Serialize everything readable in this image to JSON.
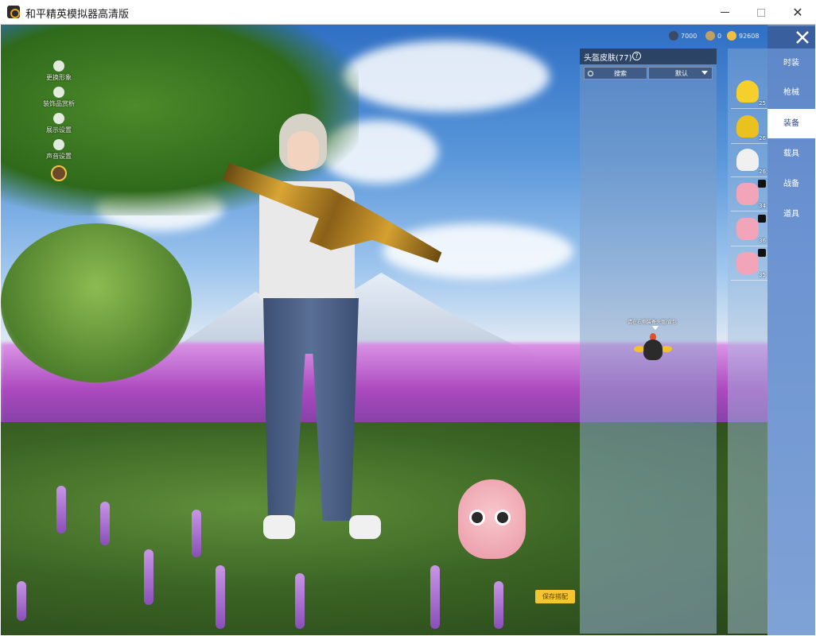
{
  "window": {
    "title": "和平精英模拟器高清版",
    "minimize_icon": "minimize-icon",
    "maximize_icon": "maximize-icon",
    "close_icon": "close-icon"
  },
  "side_menu": {
    "items": [
      {
        "label": "更换形象",
        "icon": "person-icon"
      },
      {
        "label": "装饰品赏析",
        "icon": "puzzle-icon"
      },
      {
        "label": "展示设置",
        "icon": "eye-icon"
      },
      {
        "label": "声音设置",
        "icon": "speaker-icon"
      }
    ],
    "avatar": {
      "icon": "avatar-ring-icon",
      "arrow": "↑"
    }
  },
  "currency": [
    {
      "icon": "coin-dark-icon",
      "value": "7000",
      "color": "#3a4a6a"
    },
    {
      "icon": "coin-silver-icon",
      "value": "0",
      "color": "#c0a060"
    },
    {
      "icon": "coin-gold-icon",
      "value": "92608",
      "color": "#f0c040"
    }
  ],
  "panel": {
    "title": "头盔皮肤(77)",
    "help": "?",
    "search_placeholder": "搜索",
    "sort_label": "默认",
    "preview_hint": "请在右侧装备头盔/背包"
  },
  "items": [
    {
      "name": "pineapple-helmet",
      "level": "25",
      "color": "#f5cf2b",
      "locked": false
    },
    {
      "name": "yellow-helmet",
      "level": "26",
      "color": "#e9c21f",
      "locked": false
    },
    {
      "name": "white-helmet",
      "level": "26",
      "color": "#f0f0f0",
      "locked": false
    },
    {
      "name": "pink-bear-helmet-1",
      "level": "34",
      "color": "#f2a4b8",
      "locked": true
    },
    {
      "name": "pink-bear-helmet-2",
      "level": "36",
      "color": "#f2a4b8",
      "locked": true
    },
    {
      "name": "pink-bear-helmet-3",
      "level": "35",
      "color": "#f2a4b8",
      "locked": true
    }
  ],
  "categories": [
    {
      "label": "时装",
      "active": false
    },
    {
      "label": "枪械",
      "active": false
    },
    {
      "label": "装备",
      "active": true
    },
    {
      "label": "载具",
      "active": false
    },
    {
      "label": "战备",
      "active": false
    },
    {
      "label": "道具",
      "active": false
    }
  ],
  "save_button": {
    "label": "保存搭配"
  }
}
